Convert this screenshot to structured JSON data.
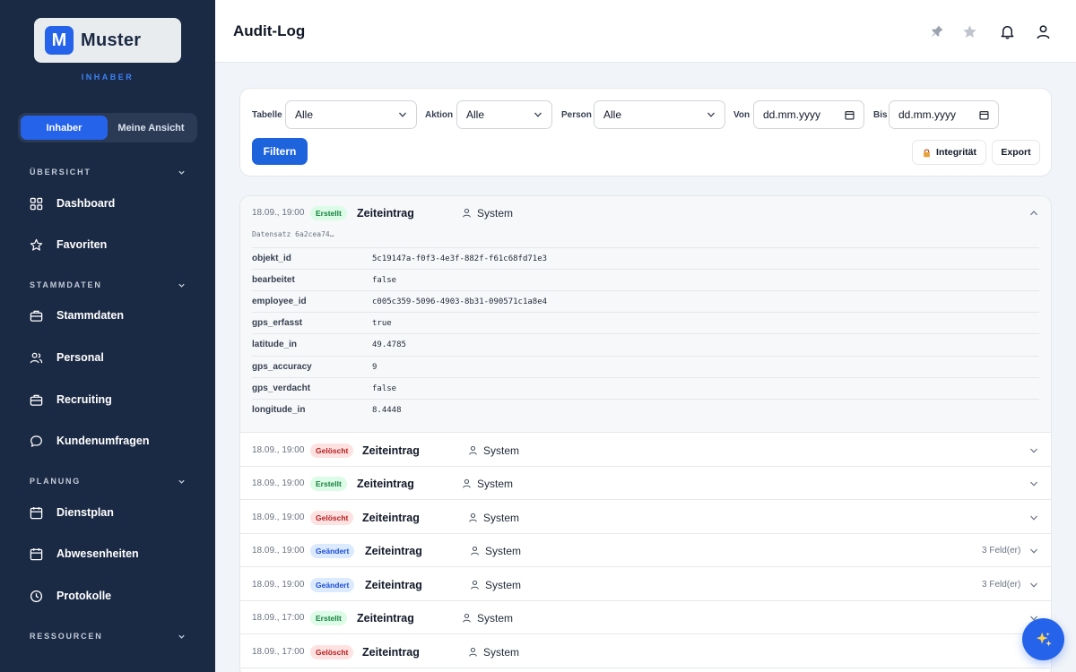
{
  "app": {
    "logo_letter": "M",
    "logo_text": "Muster",
    "role_caption": "INHABER"
  },
  "sidebar": {
    "toggle": [
      {
        "label": "Inhaber",
        "active": true
      },
      {
        "label": "Meine Ansicht",
        "active": false
      }
    ],
    "sections": [
      {
        "label": "ÜBERSICHT"
      },
      {
        "label": "STAMMDATEN"
      },
      {
        "label": "PLANUNG"
      },
      {
        "label": "RESSOURCEN"
      }
    ],
    "items": [
      {
        "label": "Dashboard",
        "icon": "grid-icon"
      },
      {
        "label": "Favoriten",
        "icon": "star-icon"
      },
      {
        "label": "Stammdaten",
        "icon": "briefcase-icon"
      },
      {
        "label": "Personal",
        "icon": "users-icon"
      },
      {
        "label": "Recruiting",
        "icon": "briefcase-icon"
      },
      {
        "label": "Kundenumfragen",
        "icon": "chat-icon"
      },
      {
        "label": "Dienstplan",
        "icon": "calendar-icon"
      },
      {
        "label": "Abwesenheiten",
        "icon": "calendar-icon"
      },
      {
        "label": "Protokolle",
        "icon": "clock-icon"
      }
    ]
  },
  "header": {
    "title": "Audit-Log",
    "icons": [
      "pin-icon",
      "star-icon",
      "bell-icon",
      "user-icon"
    ]
  },
  "filters": {
    "tabelle": {
      "label": "Tabelle",
      "value": "Alle"
    },
    "aktion": {
      "label": "Aktion",
      "value": "Alle"
    },
    "person": {
      "label": "Person",
      "value": "Alle"
    },
    "von": {
      "label": "Von",
      "value": "dd.mm.yyyy"
    },
    "bis": {
      "label": "Bis",
      "value": "dd.mm.yyyy"
    },
    "filter_button": "Filtern",
    "integrity_button": "Integrität",
    "export_button": "Export"
  },
  "log": {
    "expanded": {
      "timestamp": "18.09., 19:00",
      "action": "Erstellt",
      "action_color": "green",
      "entity": "Zeiteintrag",
      "person": "System",
      "record": "Datensatz 6a2cea74…",
      "fields": [
        {
          "key": "objekt_id",
          "value": "5c19147a-f0f3-4e3f-882f-f61c68fd71e3"
        },
        {
          "key": "bearbeitet",
          "value": "false"
        },
        {
          "key": "employee_id",
          "value": "c005c359-5096-4903-8b31-090571c1a8e4"
        },
        {
          "key": "gps_erfasst",
          "value": "true"
        },
        {
          "key": "latitude_in",
          "value": "49.4785"
        },
        {
          "key": "gps_accuracy",
          "value": "9"
        },
        {
          "key": "gps_verdacht",
          "value": "false"
        },
        {
          "key": "longitude_in",
          "value": "8.4448"
        }
      ]
    },
    "rows": [
      {
        "timestamp": "18.09., 19:00",
        "action": "Gelöscht",
        "action_color": "red",
        "entity": "Zeiteintrag",
        "person": "System",
        "fields": ""
      },
      {
        "timestamp": "18.09., 19:00",
        "action": "Erstellt",
        "action_color": "green",
        "entity": "Zeiteintrag",
        "person": "System",
        "fields": ""
      },
      {
        "timestamp": "18.09., 19:00",
        "action": "Gelöscht",
        "action_color": "red",
        "entity": "Zeiteintrag",
        "person": "System",
        "fields": ""
      },
      {
        "timestamp": "18.09., 19:00",
        "action": "Geändert",
        "action_color": "blue",
        "entity": "Zeiteintrag",
        "person": "System",
        "fields": "3 Feld(er)"
      },
      {
        "timestamp": "18.09., 19:00",
        "action": "Geändert",
        "action_color": "blue",
        "entity": "Zeiteintrag",
        "person": "System",
        "fields": "3 Feld(er)"
      },
      {
        "timestamp": "18.09., 17:00",
        "action": "Erstellt",
        "action_color": "green",
        "entity": "Zeiteintrag",
        "person": "System",
        "fields": ""
      },
      {
        "timestamp": "18.09., 17:00",
        "action": "Gelöscht",
        "action_color": "red",
        "entity": "Zeiteintrag",
        "person": "System",
        "fields": ""
      }
    ]
  },
  "fab": {
    "icon": "sparkle-icon"
  }
}
